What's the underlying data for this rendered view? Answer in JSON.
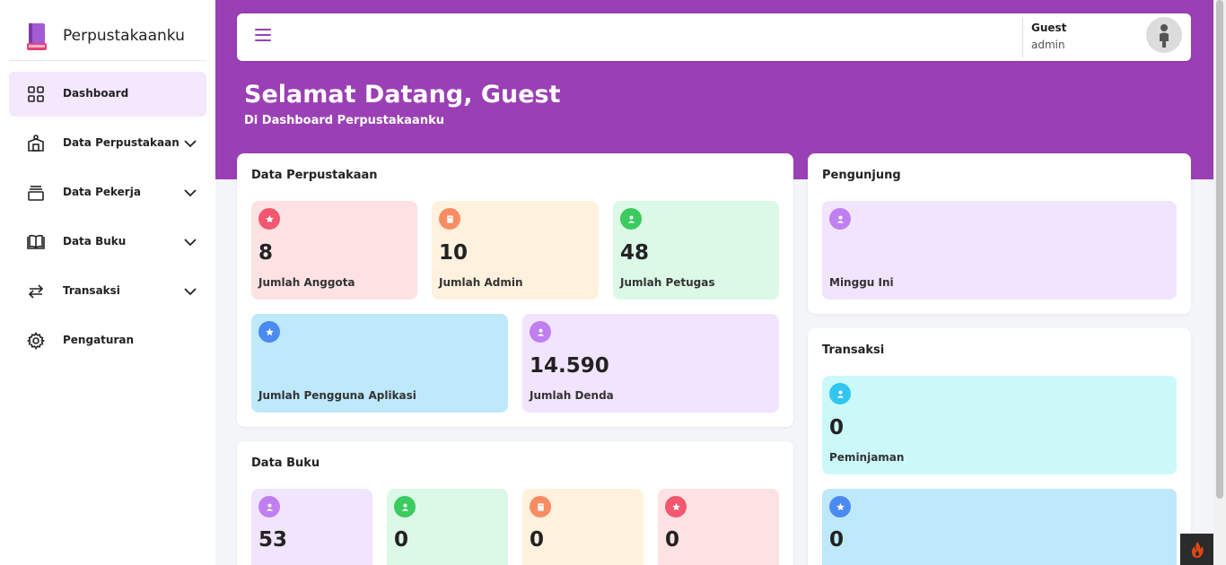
{
  "brand": {
    "name": "Perpustakaanku",
    "icon": "book-stack-icon"
  },
  "sidebar": {
    "items": [
      {
        "label": "Dashboard",
        "icon": "grid-icon",
        "active": true
      },
      {
        "label": "Data Perpustakaan",
        "icon": "library-icon",
        "expandable": true
      },
      {
        "label": "Data Pekerja",
        "icon": "layers-icon",
        "expandable": true
      },
      {
        "label": "Data Buku",
        "icon": "open-book-icon",
        "expandable": true
      },
      {
        "label": "Transaksi",
        "icon": "transfer-arrows-icon",
        "expandable": true
      },
      {
        "label": "Pengaturan",
        "icon": "gear-icon"
      }
    ]
  },
  "topbar": {
    "user_name": "Guest",
    "user_role": "admin"
  },
  "welcome": {
    "title": "Selamat Datang, Guest",
    "subtitle": "Di Dashboard Perpustakaanku"
  },
  "perpustakaan": {
    "title": "Data Perpustakaan",
    "cards": [
      {
        "value": "8",
        "label": "Jumlah Anggota",
        "icon": "star-icon",
        "bg": "#fde2e4",
        "icon_bg": "#f3576f"
      },
      {
        "value": "10",
        "label": "Jumlah Admin",
        "icon": "book-icon",
        "bg": "#fff1de",
        "icon_bg": "#f98c63"
      },
      {
        "value": "48",
        "label": "Jumlah Petugas",
        "icon": "user-icon",
        "bg": "#dcf8e7",
        "icon_bg": "#3ccb5e"
      },
      {
        "value": "",
        "label": "Jumlah Pengguna Aplikasi",
        "icon": "star-icon",
        "bg": "#bde9fb",
        "icon_bg": "#4a8af1"
      },
      {
        "value": "14.590",
        "label": "Jumlah Denda",
        "icon": "user-icon",
        "bg": "#f1e4fd",
        "icon_bg": "#c07ff0"
      }
    ]
  },
  "pengunjung": {
    "title": "Pengunjung",
    "card": {
      "value": "",
      "label": "Minggu Ini",
      "icon": "user-icon",
      "bg": "#f1e4fd",
      "icon_bg": "#c07ff0"
    }
  },
  "transaksi": {
    "title": "Transaksi",
    "cards": [
      {
        "value": "0",
        "label": "Peminjaman",
        "icon": "user-icon",
        "bg": "#cbf9fa",
        "icon_bg": "#31c6ef"
      },
      {
        "value": "0",
        "label": "",
        "icon": "star-icon",
        "bg": "#bde9fb",
        "icon_bg": "#4a8af1"
      }
    ]
  },
  "buku": {
    "title": "Data Buku",
    "cards": [
      {
        "value": "53",
        "icon": "user-icon",
        "bg": "#f1e4fd",
        "icon_bg": "#c07ff0"
      },
      {
        "value": "0",
        "icon": "user-icon",
        "bg": "#dcf8e7",
        "icon_bg": "#3ccb5e"
      },
      {
        "value": "0",
        "icon": "book-icon",
        "bg": "#fff1de",
        "icon_bg": "#f98c63"
      },
      {
        "value": "0",
        "icon": "star-icon",
        "bg": "#fde2e4",
        "icon_bg": "#f3576f"
      }
    ]
  },
  "colors": {
    "primary": "#9b3fb5",
    "active_bg": "#f3e8fd"
  }
}
